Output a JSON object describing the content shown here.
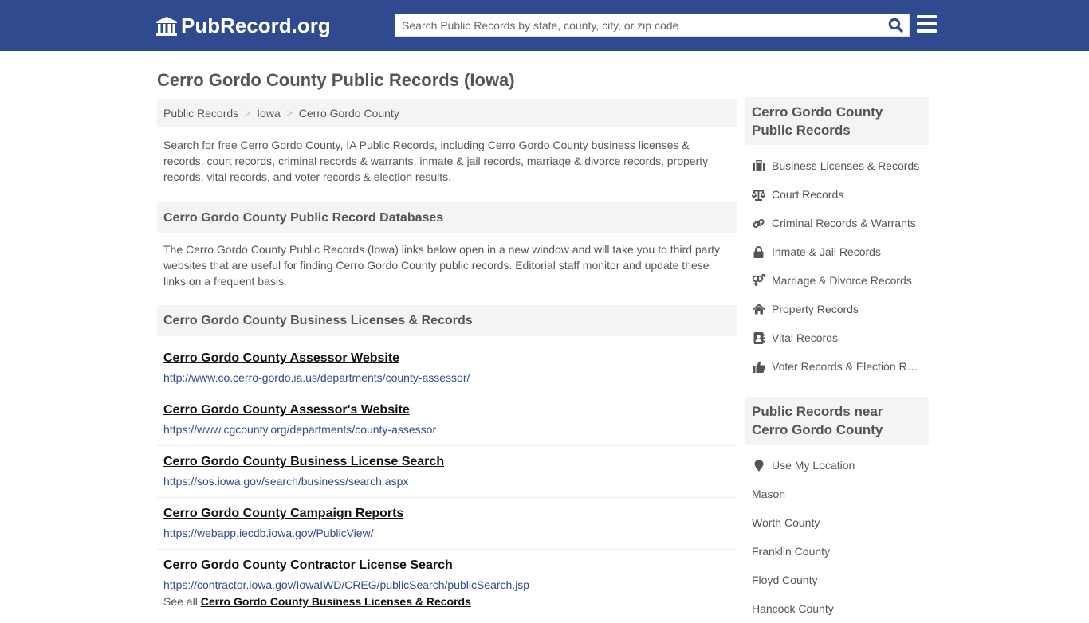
{
  "header": {
    "logo_text": "PubRecord.org",
    "search_placeholder": "Search Public Records by state, county, city, or zip code",
    "search_value": "",
    "brand_color": "#2f4a8e"
  },
  "page_title": "Cerro Gordo County Public Records (Iowa)",
  "breadcrumb": [
    {
      "label": "Public Records"
    },
    {
      "label": "Iowa"
    },
    {
      "label": "Cerro Gordo County"
    }
  ],
  "breadcrumb_separator": ">",
  "intro": "Search for free Cerro Gordo County, IA Public Records, including Cerro Gordo County business licenses & records, court records, criminal records & warrants, inmate & jail records, marriage & divorce records, property records, vital records, and voter records & election results.",
  "databases": {
    "heading": "Cerro Gordo County Public Record Databases",
    "text": "The Cerro Gordo County Public Records (Iowa) links below open in a new window and will take you to third party websites that are useful for finding Cerro Gordo County public records. Editorial staff monitor and update these links on a frequent basis."
  },
  "business": {
    "heading": "Cerro Gordo County Business Licenses & Records",
    "links": [
      {
        "title": "Cerro Gordo County Assessor Website",
        "url": "http://www.co.cerro-gordo.ia.us/departments/county-assessor/"
      },
      {
        "title": "Cerro Gordo County Assessor's Website",
        "url": "https://www.cgcounty.org/departments/county-assessor"
      },
      {
        "title": "Cerro Gordo County Business License Search",
        "url": "https://sos.iowa.gov/search/business/search.aspx"
      },
      {
        "title": "Cerro Gordo County Campaign Reports",
        "url": "https://webapp.iecdb.iowa.gov/PublicView/"
      },
      {
        "title": "Cerro Gordo County Contractor License Search",
        "url": "https://contractor.iowa.gov/IowaIWD/CREG/publicSearch/publicSearch.jsp"
      }
    ],
    "see_all_prefix": "See all",
    "see_all_link": "Cerro Gordo County Business Licenses & Records"
  },
  "sidebar": {
    "records_heading": "Cerro Gordo County Public Records",
    "records": [
      {
        "label": "Business Licenses & Records",
        "icon": "briefcase-icon"
      },
      {
        "label": "Court Records",
        "icon": "scale-icon"
      },
      {
        "label": "Criminal Records & Warrants",
        "icon": "link-icon"
      },
      {
        "label": "Inmate & Jail Records",
        "icon": "lock-icon"
      },
      {
        "label": "Marriage & Divorce Records",
        "icon": "venus-mars-icon"
      },
      {
        "label": "Property Records",
        "icon": "home-icon"
      },
      {
        "label": "Vital Records",
        "icon": "address-book-icon"
      },
      {
        "label": "Voter Records & Election Results",
        "icon": "thumbs-up-icon"
      }
    ],
    "near_heading": "Public Records near Cerro Gordo County",
    "use_location": "Use My Location",
    "near": [
      {
        "label": "Mason"
      },
      {
        "label": "Worth County"
      },
      {
        "label": "Franklin County"
      },
      {
        "label": "Floyd County"
      },
      {
        "label": "Hancock County"
      }
    ]
  }
}
